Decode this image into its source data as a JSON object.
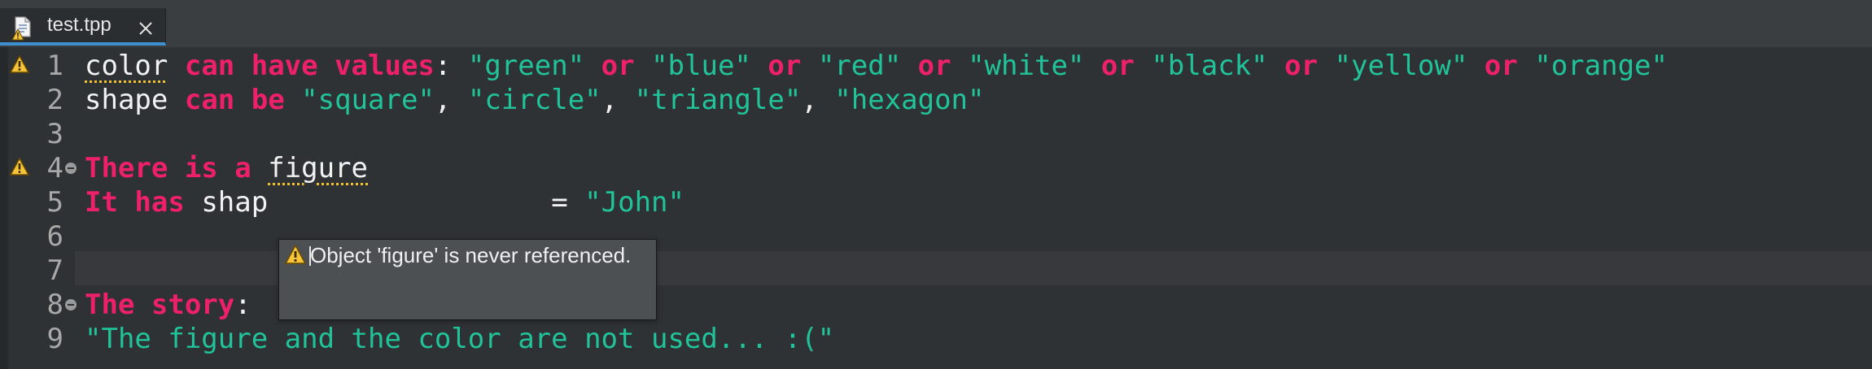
{
  "tab": {
    "label": "test.tpp",
    "close_icon": "close-icon",
    "file_icon": "file-icon"
  },
  "colors": {
    "keyword": "#ee1f6b",
    "string": "#21c49a",
    "text": "#f2f2f2",
    "warning": "#f0c030",
    "tab_accent": "#3d8fd0"
  },
  "lines": [
    {
      "number": "1",
      "warning": true,
      "fold": false,
      "tokens": [
        {
          "text": "color",
          "type": "pl",
          "warn": true
        },
        {
          "text": " ",
          "type": "pl"
        },
        {
          "text": "can have values",
          "type": "kw"
        },
        {
          "text": ": ",
          "type": "pl"
        },
        {
          "text": "\"green\"",
          "type": "str"
        },
        {
          "text": " ",
          "type": "pl"
        },
        {
          "text": "or",
          "type": "kw"
        },
        {
          "text": " ",
          "type": "pl"
        },
        {
          "text": "\"blue\"",
          "type": "str"
        },
        {
          "text": " ",
          "type": "pl"
        },
        {
          "text": "or",
          "type": "kw"
        },
        {
          "text": " ",
          "type": "pl"
        },
        {
          "text": "\"red\"",
          "type": "str"
        },
        {
          "text": " ",
          "type": "pl"
        },
        {
          "text": "or",
          "type": "kw"
        },
        {
          "text": " ",
          "type": "pl"
        },
        {
          "text": "\"white\"",
          "type": "str"
        },
        {
          "text": " ",
          "type": "pl"
        },
        {
          "text": "or",
          "type": "kw"
        },
        {
          "text": " ",
          "type": "pl"
        },
        {
          "text": "\"black\"",
          "type": "str"
        },
        {
          "text": " ",
          "type": "pl"
        },
        {
          "text": "or",
          "type": "kw"
        },
        {
          "text": " ",
          "type": "pl"
        },
        {
          "text": "\"yellow\"",
          "type": "str"
        },
        {
          "text": " ",
          "type": "pl"
        },
        {
          "text": "or",
          "type": "kw"
        },
        {
          "text": " ",
          "type": "pl"
        },
        {
          "text": "\"orange\"",
          "type": "str"
        }
      ]
    },
    {
      "number": "2",
      "warning": false,
      "fold": false,
      "tokens": [
        {
          "text": "shape",
          "type": "pl"
        },
        {
          "text": " ",
          "type": "pl"
        },
        {
          "text": "can be",
          "type": "kw"
        },
        {
          "text": " ",
          "type": "pl"
        },
        {
          "text": "\"square\"",
          "type": "str"
        },
        {
          "text": ", ",
          "type": "pl"
        },
        {
          "text": "\"circle\"",
          "type": "str"
        },
        {
          "text": ", ",
          "type": "pl"
        },
        {
          "text": "\"triangle\"",
          "type": "str"
        },
        {
          "text": ", ",
          "type": "pl"
        },
        {
          "text": "\"hexagon\"",
          "type": "str"
        }
      ]
    },
    {
      "number": "3",
      "warning": false,
      "fold": false,
      "tokens": []
    },
    {
      "number": "4",
      "warning": true,
      "fold": true,
      "tokens": [
        {
          "text": "There is a",
          "type": "kw"
        },
        {
          "text": " ",
          "type": "pl"
        },
        {
          "text": "figure",
          "type": "pl",
          "warn": true
        }
      ]
    },
    {
      "number": "5",
      "warning": false,
      "fold": false,
      "tokens": [
        {
          "text": "It has",
          "type": "kw"
        },
        {
          "text": " ",
          "type": "pl"
        },
        {
          "text": "shap",
          "type": "pl"
        },
        {
          "text": "                 ",
          "type": "pl"
        },
        {
          "text": "= ",
          "type": "pl"
        },
        {
          "text": "\"John\"",
          "type": "str"
        }
      ]
    },
    {
      "number": "6",
      "warning": false,
      "fold": false,
      "tokens": []
    },
    {
      "number": "7",
      "warning": false,
      "fold": false,
      "tokens": []
    },
    {
      "number": "8",
      "warning": false,
      "fold": true,
      "tokens": [
        {
          "text": "The story",
          "type": "kw"
        },
        {
          "text": ":",
          "type": "pl"
        }
      ]
    },
    {
      "number": "9",
      "warning": false,
      "fold": false,
      "tokens": [
        {
          "text": "\"The figure and the color are not used... :(\"",
          "type": "str"
        }
      ]
    }
  ],
  "tooltip": {
    "message": "Object 'figure' is never referenced.",
    "icon": "warning-icon"
  }
}
